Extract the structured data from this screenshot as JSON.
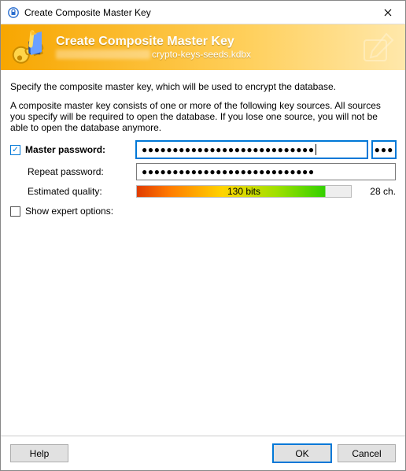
{
  "window": {
    "title": "Create Composite Master Key"
  },
  "header": {
    "title": "Create Composite Master Key",
    "filename_suffix": "crypto-keys-seeds.kdbx"
  },
  "intro": {
    "line1": "Specify the composite master key, which will be used to encrypt the database.",
    "line2": "A composite master key consists of one or more of the following key sources. All sources you specify will be required to open the database. If you lose one source, you will not be able to open the database anymore."
  },
  "form": {
    "master_password_label": "Master password:",
    "repeat_password_label": "Repeat password:",
    "estimated_quality_label": "Estimated quality:",
    "show_expert_label": "Show expert options:",
    "master_password_value": "●●●●●●●●●●●●●●●●●●●●●●●●●●●●",
    "repeat_password_value": "●●●●●●●●●●●●●●●●●●●●●●●●●●●●",
    "reveal_button": "●●●",
    "quality_text": "130 bits",
    "char_count": "28 ch."
  },
  "buttons": {
    "help": "Help",
    "ok": "OK",
    "cancel": "Cancel"
  }
}
